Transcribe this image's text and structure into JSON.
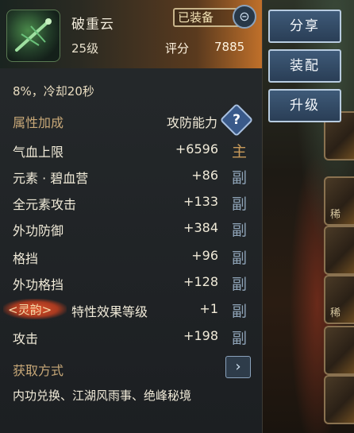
{
  "item": {
    "name": "破重云",
    "level": "25级",
    "equipped": "已装备",
    "score_label": "评分",
    "score_value": "7885",
    "icon": "jade-sword-icon"
  },
  "effect_text": "8%，冷却20秒",
  "attributes": {
    "section_title": "属性加成",
    "attack_label": "攻防能力",
    "help_glyph": "?",
    "rows": [
      {
        "name": "气血上限",
        "value": "+6596",
        "tag": "主"
      },
      {
        "name": "元素 · 碧血营",
        "value": "+86",
        "tag": "副"
      },
      {
        "name": "全元素攻击",
        "value": "+133",
        "tag": "副"
      },
      {
        "name": "外功防御",
        "value": "+384",
        "tag": "副"
      },
      {
        "name": "格挡",
        "value": "+96",
        "tag": "副"
      },
      {
        "name": "外功格挡",
        "value": "+128",
        "tag": "副"
      },
      {
        "spirit": "<灵韵>",
        "name": "特性效果等级",
        "value": "+1",
        "tag": "副"
      },
      {
        "name": "攻击",
        "value": "+198",
        "tag": "副"
      }
    ]
  },
  "obtain": {
    "title": "获取方式",
    "text": "内功兑换、江湖风雨事、绝峰秘境"
  },
  "buttons": {
    "share": "分享",
    "equip": "装配",
    "upgrade": "升级"
  },
  "slots": [
    "稀",
    "稀"
  ],
  "colors": {
    "main_tag": "#c89a5a",
    "sub_tag": "#8fa4b8",
    "section": "#c8a878"
  }
}
